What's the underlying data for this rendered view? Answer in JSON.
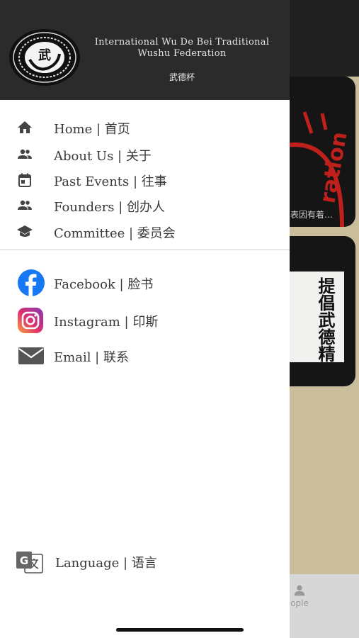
{
  "header": {
    "title": "International Wu De Bei Traditional Wushu Federation",
    "subtitle": "武德杯",
    "logo_text": "武"
  },
  "nav": {
    "items": [
      {
        "label": "Home | 首页",
        "icon": "home-icon"
      },
      {
        "label": "About Us | 关于",
        "icon": "people-icon"
      },
      {
        "label": "Past Events | 往事",
        "icon": "calendar-icon"
      },
      {
        "label": "Founders | 创办人",
        "icon": "people-icon"
      },
      {
        "label": "Committee | 委员会",
        "icon": "graduation-cap-icon"
      }
    ]
  },
  "social": {
    "items": [
      {
        "label": "Facebook | 脸书",
        "icon": "facebook-icon"
      },
      {
        "label": "Instagram | 印斯",
        "icon": "instagram-icon"
      },
      {
        "label": "Email | 联系",
        "icon": "email-icon"
      }
    ]
  },
  "language": {
    "label": "Language | 语言",
    "icon": "translate-icon"
  },
  "background": {
    "card1_caption": "表因有着…",
    "card2_poster_text": "提倡武德精",
    "card1_art_text": "ration",
    "bottom_tab_label": "People"
  },
  "colors": {
    "drawer_header": "#2b2b2b",
    "facebook_blue": "#1877f2",
    "accent_red": "#c0201c"
  }
}
